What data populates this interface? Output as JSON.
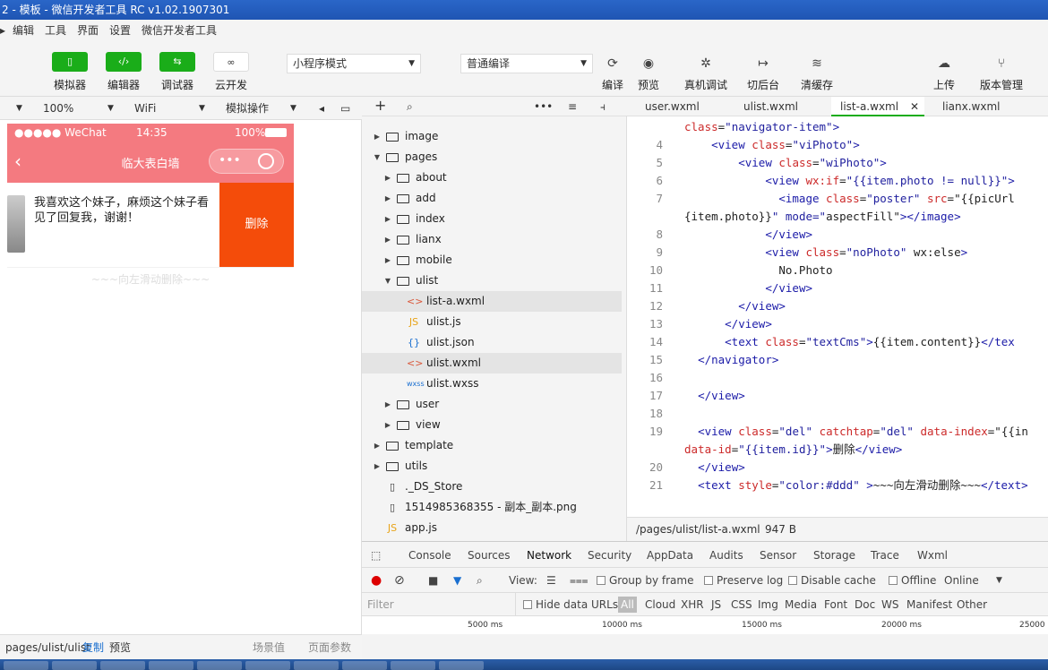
{
  "window": {
    "title": "2 - 模板 - 微信开发者工具 RC v1.02.1907301"
  },
  "menu": {
    "items": [
      "编辑",
      "工具",
      "界面",
      "设置",
      "微信开发者工具"
    ]
  },
  "toolbar": {
    "simulator": "模拟器",
    "editor": "编辑器",
    "debugger": "调试器",
    "cloud": "云开发",
    "mode": "小程序模式",
    "compile_mode": "普通编译",
    "compile": "编译",
    "preview": "预览",
    "remote_debug": "真机调试",
    "background": "切后台",
    "clear_cache": "清缓存",
    "upload": "上传",
    "version": "版本管理"
  },
  "simbar": {
    "zoom": "100%",
    "network": "WiFi",
    "action": "模拟操作"
  },
  "phone": {
    "carrier": "●●●●● WeChat",
    "time": "14:35",
    "battery": "100%",
    "title": "临大表白墙",
    "post_text": "我喜欢这个妹子，麻烦这个妹子看见了回复我，谢谢！",
    "delete_label": "删除",
    "swipe_hint": "~~~向左滑动删除~~~"
  },
  "tree": {
    "items": [
      {
        "name": "image",
        "type": "folder",
        "depth": 0,
        "open": false
      },
      {
        "name": "pages",
        "type": "folder",
        "depth": 0,
        "open": true
      },
      {
        "name": "about",
        "type": "folder",
        "depth": 1,
        "open": false
      },
      {
        "name": "add",
        "type": "folder",
        "depth": 1,
        "open": false
      },
      {
        "name": "index",
        "type": "folder",
        "depth": 1,
        "open": false
      },
      {
        "name": "lianx",
        "type": "folder",
        "depth": 1,
        "open": false
      },
      {
        "name": "mobile",
        "type": "folder",
        "depth": 1,
        "open": false
      },
      {
        "name": "ulist",
        "type": "folder",
        "depth": 1,
        "open": true
      },
      {
        "name": "list-a.wxml",
        "type": "wxml",
        "depth": 2
      },
      {
        "name": "ulist.js",
        "type": "js",
        "depth": 2
      },
      {
        "name": "ulist.json",
        "type": "json",
        "depth": 2
      },
      {
        "name": "ulist.wxml",
        "type": "wxml",
        "depth": 2
      },
      {
        "name": "ulist.wxss",
        "type": "wxss",
        "depth": 2
      },
      {
        "name": "user",
        "type": "folder",
        "depth": 1,
        "open": false
      },
      {
        "name": "view",
        "type": "folder",
        "depth": 1,
        "open": false
      },
      {
        "name": "template",
        "type": "folder",
        "depth": 0,
        "open": false
      },
      {
        "name": "utils",
        "type": "folder",
        "depth": 0,
        "open": false
      },
      {
        "name": "._DS_Store",
        "type": "file",
        "depth": 0
      },
      {
        "name": "1514985368355 - 副本_副本.png",
        "type": "file",
        "depth": 0
      },
      {
        "name": "app.js",
        "type": "js",
        "depth": 0
      }
    ],
    "type_icons": {
      "wxml": "<>",
      "js": "JS",
      "json": "{}",
      "wxss": "wxss",
      "file": "▯"
    }
  },
  "editor": {
    "tabs": [
      "user.wxml",
      "ulist.wxml",
      "list-a.wxml",
      "lianx.wxml"
    ],
    "active_tab": 2,
    "file_path": "/pages/ulist/list-a.wxml",
    "file_size": "947 B",
    "lines": [
      {
        "n": "",
        "code": "class=\"navigator-item\">"
      },
      {
        "n": "4",
        "code": "    <view class=\"viPhoto\">"
      },
      {
        "n": "5",
        "code": "        <view class=\"wiPhoto\">"
      },
      {
        "n": "6",
        "code": "            <view wx:if=\"{{item.photo != null}}\">"
      },
      {
        "n": "7",
        "code": "              <image class=\"poster\" src=\"{{picUrl"
      },
      {
        "n": "",
        "code": "{item.photo}}\" mode=\"aspectFill\"></image>"
      },
      {
        "n": "8",
        "code": "            </view>"
      },
      {
        "n": "9",
        "code": "            <view class=\"noPhoto\" wx:else>"
      },
      {
        "n": "10",
        "code": "              No.Photo"
      },
      {
        "n": "11",
        "code": "            </view>"
      },
      {
        "n": "12",
        "code": "        </view>"
      },
      {
        "n": "13",
        "code": "      </view>"
      },
      {
        "n": "14",
        "code": "      <text class=\"textCms\">{{item.content}}</tex"
      },
      {
        "n": "15",
        "code": "  </navigator>"
      },
      {
        "n": "16",
        "code": ""
      },
      {
        "n": "17",
        "code": "  </view>"
      },
      {
        "n": "18",
        "code": ""
      },
      {
        "n": "19",
        "code": "  <view class=\"del\" catchtap=\"del\" data-index=\"{{in"
      },
      {
        "n": "",
        "code": "data-id=\"{{item.id}}\">删除</view>"
      },
      {
        "n": "20",
        "code": "  </view>"
      },
      {
        "n": "21",
        "code": "  <text style=\"color:#ddd\" >~~~向左滑动删除~~~</text>"
      }
    ]
  },
  "devtools": {
    "tabs": [
      "Console",
      "Sources",
      "Network",
      "Security",
      "AppData",
      "Audits",
      "Sensor",
      "Storage",
      "Trace",
      "Wxml"
    ],
    "active_tab": "Network",
    "view_label": "View:",
    "group_by_frame": "Group by frame",
    "preserve_log": "Preserve log",
    "disable_cache": "Disable cache",
    "offline": "Offline",
    "online": "Online",
    "filter_placeholder": "Filter",
    "hide_data_urls": "Hide data URLs",
    "filter_types": [
      "All",
      "Cloud",
      "XHR",
      "JS",
      "CSS",
      "Img",
      "Media",
      "Font",
      "Doc",
      "WS",
      "Manifest",
      "Other"
    ],
    "timeline": [
      "5000 ms",
      "10000 ms",
      "15000 ms",
      "20000 ms",
      "25000"
    ]
  },
  "statusbar": {
    "path": "pages/ulist/ulist",
    "copy": "复制",
    "preview": "预览",
    "scene": "场景值",
    "params": "页面参数"
  },
  "colors": {
    "accent": "#1aad19",
    "nav": "#f47a80",
    "delete": "#f44c0a"
  }
}
